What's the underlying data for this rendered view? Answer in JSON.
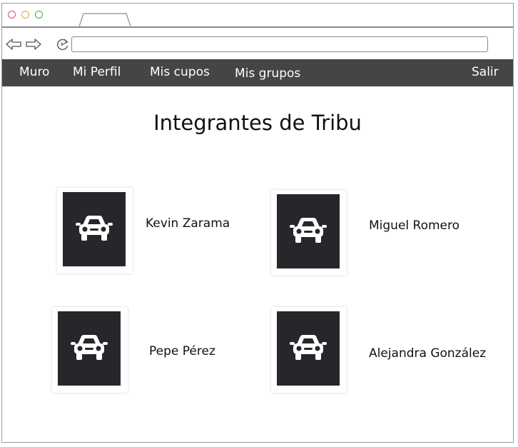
{
  "browser": {
    "address_value": "",
    "icons": {
      "back": "arrow-left-icon",
      "forward": "arrow-right-icon",
      "reload": "reload-icon"
    }
  },
  "navbar": {
    "background": "#454545",
    "items": [
      {
        "label": "Muro"
      },
      {
        "label": "Mi Perfil"
      },
      {
        "label": "Mis cupos"
      },
      {
        "label": "Mis grupos"
      }
    ],
    "logout_label": "Salir"
  },
  "page": {
    "title": "Integrantes de Tribu"
  },
  "members": [
    {
      "name": "Kevin Zarama",
      "avatar_icon": "car-icon"
    },
    {
      "name": "Miguel Romero",
      "avatar_icon": "car-icon"
    },
    {
      "name": "Pepe Pérez",
      "avatar_icon": "car-icon"
    },
    {
      "name": "Alejandra González",
      "avatar_icon": "car-icon"
    }
  ],
  "colors": {
    "avatar_background": "#25272b",
    "icon": "#ffffff"
  }
}
